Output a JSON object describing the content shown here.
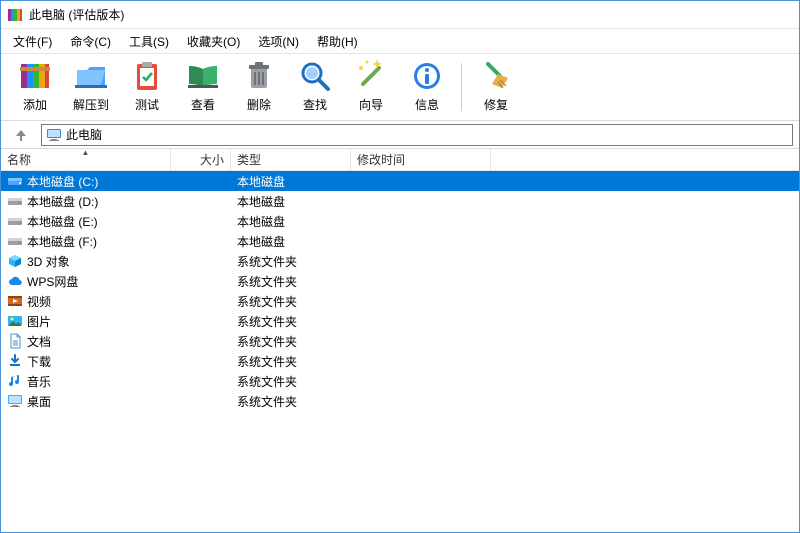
{
  "window": {
    "title": "此电脑 (评估版本)"
  },
  "menu": {
    "file": "文件(F)",
    "cmd": "命令(C)",
    "tools": "工具(S)",
    "fav": "收藏夹(O)",
    "opts": "选项(N)",
    "help": "帮助(H)"
  },
  "toolbar": {
    "add": "添加",
    "extract": "解压到",
    "test": "测试",
    "view": "查看",
    "delete": "删除",
    "find": "查找",
    "wizard": "向导",
    "info": "信息",
    "repair": "修复"
  },
  "address": {
    "value": "此电脑"
  },
  "columns": {
    "name": "名称",
    "size": "大小",
    "type": "类型",
    "date": "修改时间"
  },
  "rows": [
    {
      "icon": "drive-c",
      "name": "本地磁盘 (C:)",
      "size": "",
      "type": "本地磁盘",
      "date": "",
      "selected": true
    },
    {
      "icon": "drive",
      "name": "本地磁盘 (D:)",
      "size": "",
      "type": "本地磁盘",
      "date": ""
    },
    {
      "icon": "drive",
      "name": "本地磁盘 (E:)",
      "size": "",
      "type": "本地磁盘",
      "date": ""
    },
    {
      "icon": "drive",
      "name": "本地磁盘 (F:)",
      "size": "",
      "type": "本地磁盘",
      "date": ""
    },
    {
      "icon": "3dobjects",
      "name": "3D 对象",
      "size": "",
      "type": "系统文件夹",
      "date": ""
    },
    {
      "icon": "cloud",
      "name": "WPS网盘",
      "size": "",
      "type": "系统文件夹",
      "date": ""
    },
    {
      "icon": "video",
      "name": "视频",
      "size": "",
      "type": "系统文件夹",
      "date": ""
    },
    {
      "icon": "pictures",
      "name": "图片",
      "size": "",
      "type": "系统文件夹",
      "date": ""
    },
    {
      "icon": "docs",
      "name": "文档",
      "size": "",
      "type": "系统文件夹",
      "date": ""
    },
    {
      "icon": "downloads",
      "name": "下载",
      "size": "",
      "type": "系统文件夹",
      "date": ""
    },
    {
      "icon": "music",
      "name": "音乐",
      "size": "",
      "type": "系统文件夹",
      "date": ""
    },
    {
      "icon": "desktop",
      "name": "桌面",
      "size": "",
      "type": "系统文件夹",
      "date": ""
    }
  ]
}
